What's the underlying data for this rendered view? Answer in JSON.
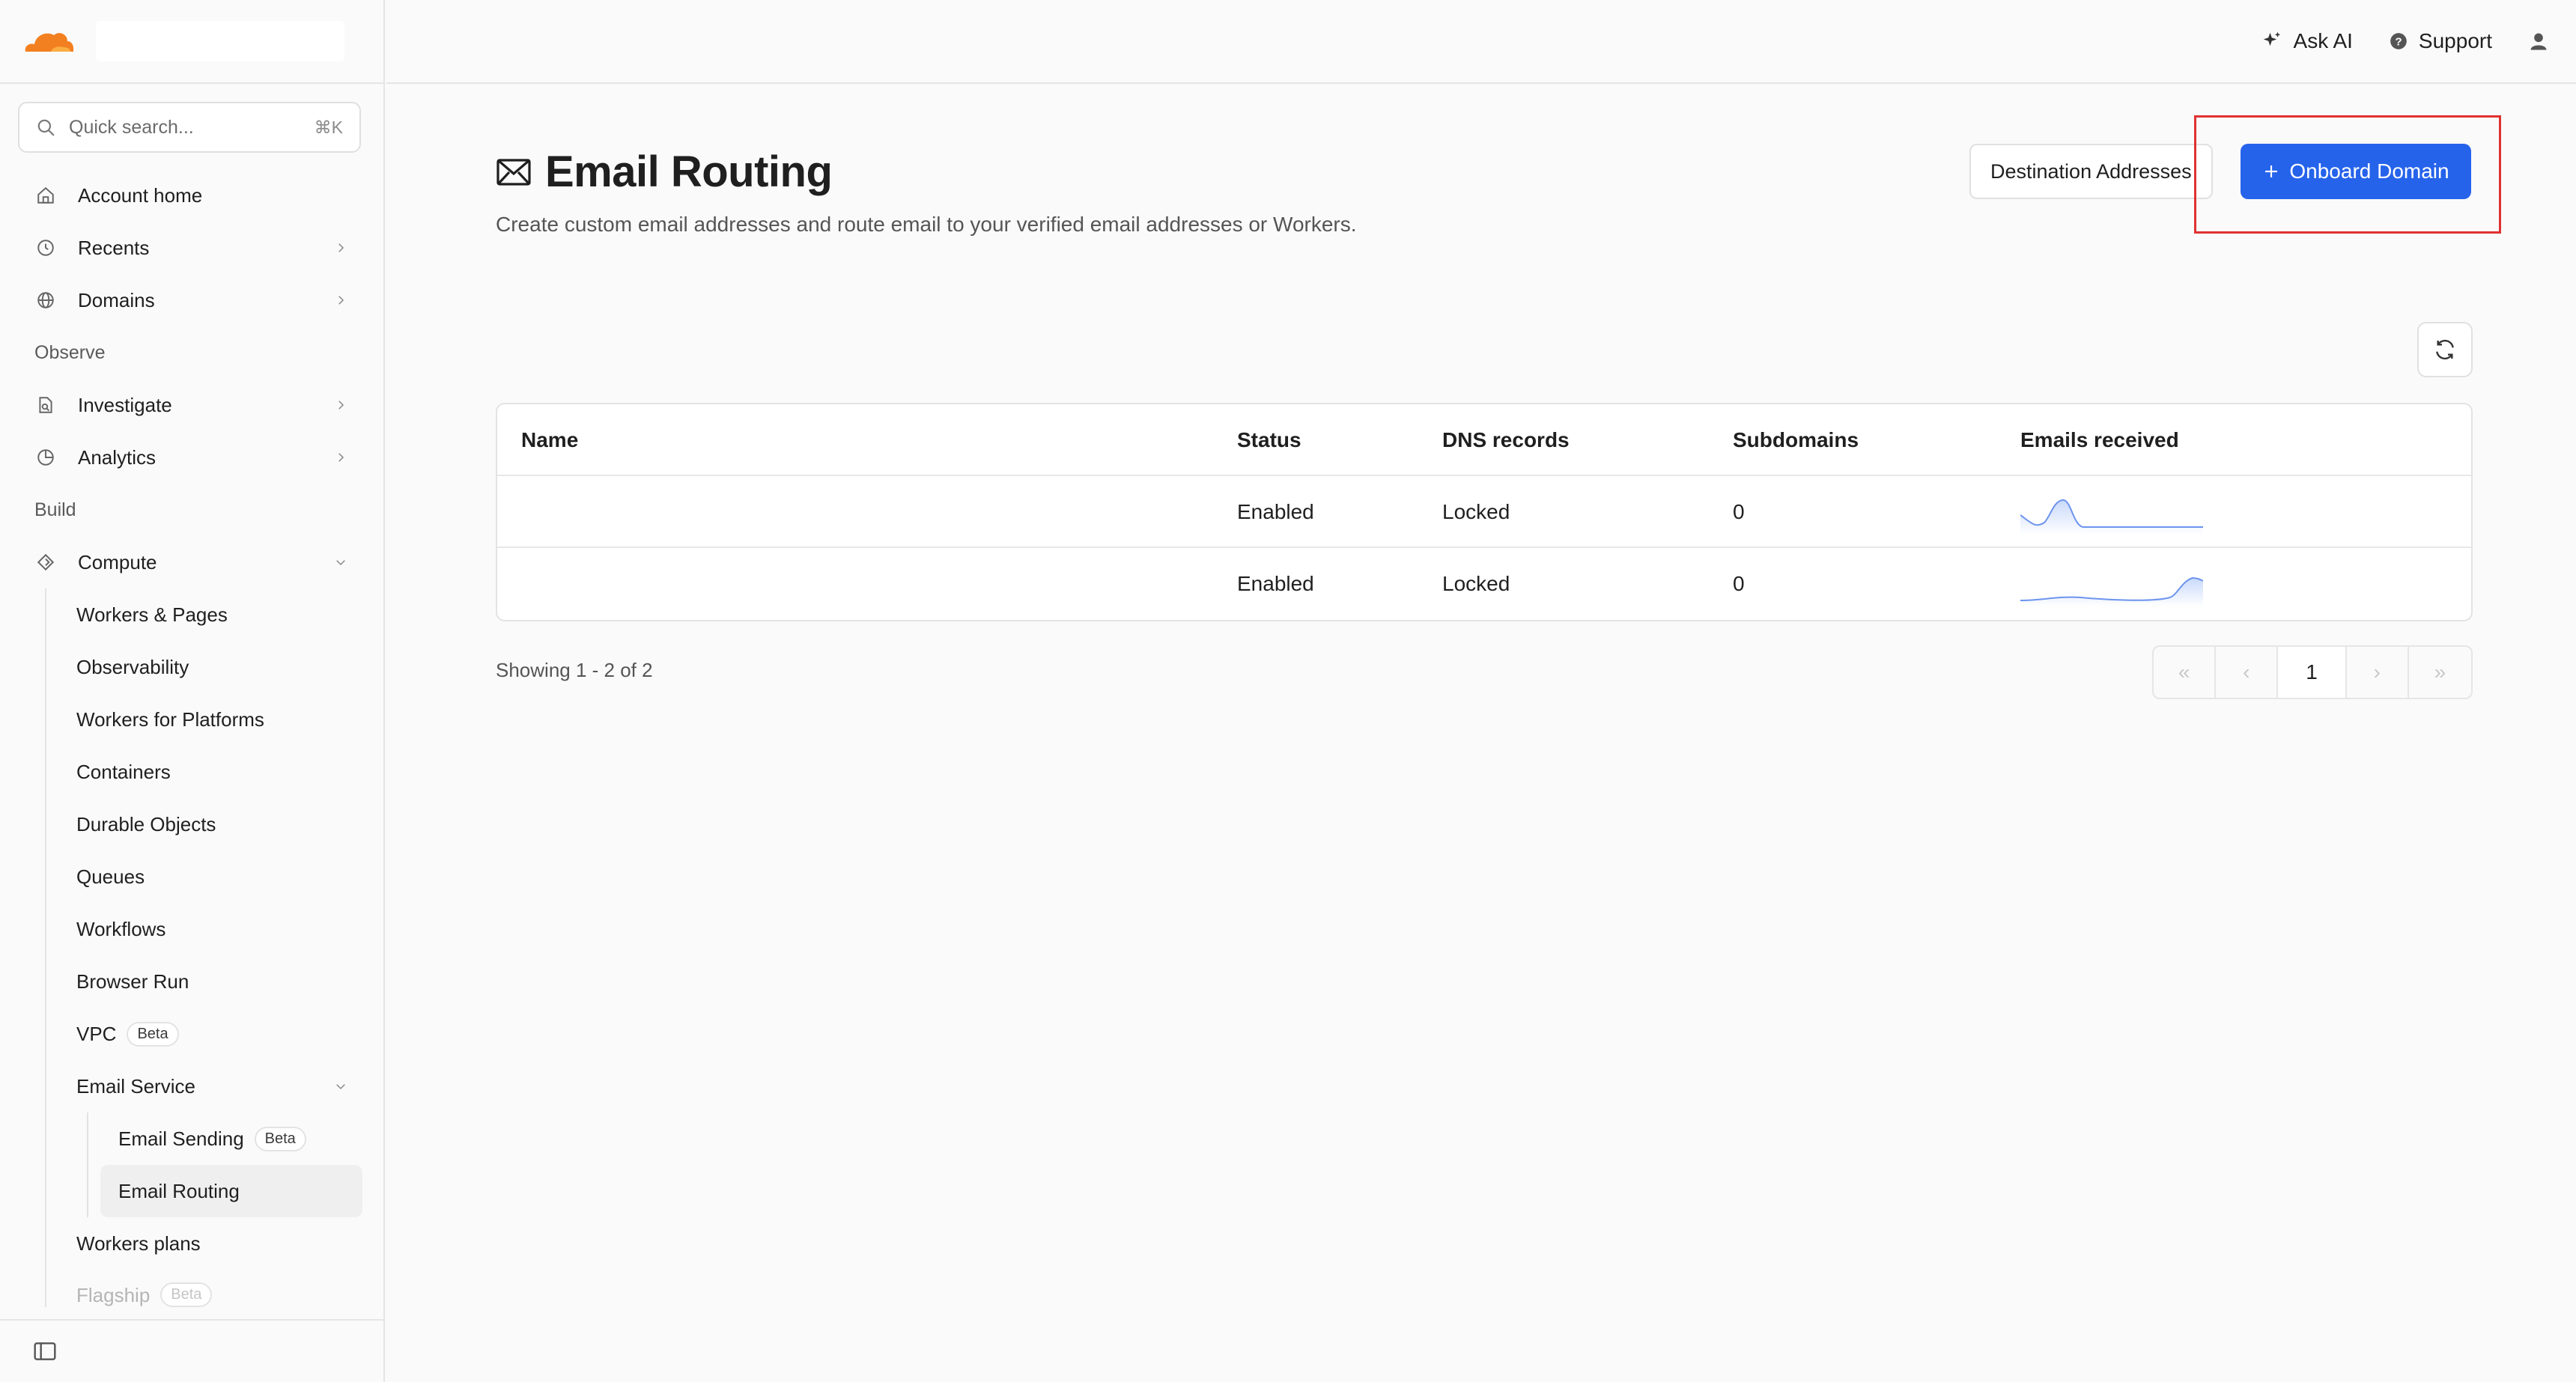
{
  "header": {
    "ask_ai": "Ask AI",
    "support": "Support"
  },
  "sidebar": {
    "search_placeholder": "Quick search...",
    "search_shortcut": "⌘K",
    "items": {
      "account_home": "Account home",
      "recents": "Recents",
      "domains": "Domains",
      "observe_section": "Observe",
      "investigate": "Investigate",
      "analytics": "Analytics",
      "build_section": "Build",
      "compute": "Compute",
      "workers_pages": "Workers & Pages",
      "observability": "Observability",
      "workers_platforms": "Workers for Platforms",
      "containers": "Containers",
      "durable_objects": "Durable Objects",
      "queues": "Queues",
      "workflows": "Workflows",
      "browser_run": "Browser Run",
      "vpc": "VPC",
      "vpc_badge": "Beta",
      "email_service": "Email Service",
      "email_sending": "Email Sending",
      "email_sending_badge": "Beta",
      "email_routing": "Email Routing",
      "workers_plans": "Workers plans",
      "flagship": "Flagship",
      "flagship_badge": "Beta"
    }
  },
  "page": {
    "title": "Email Routing",
    "description": "Create custom email addresses and route email to your verified email addresses or Workers.",
    "destination_button": "Destination Addresses",
    "onboard_button": "Onboard Domain"
  },
  "table": {
    "columns": [
      "Name",
      "Status",
      "DNS records",
      "Subdomains",
      "Emails received"
    ],
    "rows": [
      {
        "name": "",
        "status": "Enabled",
        "dns": "Locked",
        "subdomains": "0"
      },
      {
        "name": "",
        "status": "Enabled",
        "dns": "Locked",
        "subdomains": "0"
      }
    ]
  },
  "pagination": {
    "showing": "Showing 1 - 2 of 2",
    "current_page": "1"
  },
  "colors": {
    "accent": "#2563eb",
    "highlight": "#e03131",
    "brand": "#f38020"
  }
}
